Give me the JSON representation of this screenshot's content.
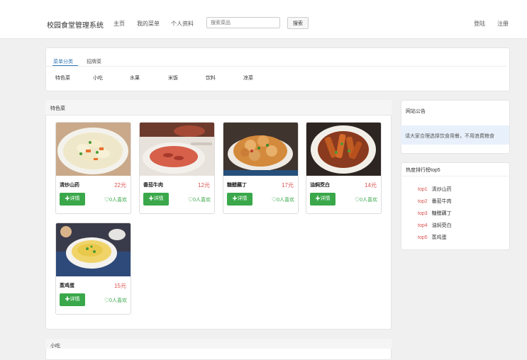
{
  "header": {
    "brand": "校园食堂管理系统",
    "nav": [
      "主页",
      "我的菜单",
      "个人资料"
    ],
    "search_placeholder": "搜索菜品",
    "search_button": "搜索",
    "login": "登陆",
    "register": "注册"
  },
  "menu": {
    "tabs": [
      "菜单分类",
      "招牌菜"
    ],
    "active_tab": "菜单分类",
    "categories": [
      "特色菜",
      "小吃",
      "水果",
      "米饭",
      "饮料",
      "凉菜"
    ]
  },
  "featured_section": {
    "title": "特色菜",
    "items": [
      {
        "name": "清炒山药",
        "price": "22元",
        "button": "✚详情",
        "likes": "♡0人喜欢"
      },
      {
        "name": "番茄牛肉",
        "price": "12元",
        "button": "✚详情",
        "likes": "♡0人喜欢"
      },
      {
        "name": "糖醋藕丁",
        "price": "17元",
        "button": "✚详情",
        "likes": "♡0人喜欢"
      },
      {
        "name": "油焖茭白",
        "price": "14元",
        "button": "✚详情",
        "likes": "♡0人喜欢"
      },
      {
        "name": "蒸鸡蛋",
        "price": "15元",
        "button": "✚详情",
        "likes": "♡0人喜欢"
      }
    ]
  },
  "snack_section": {
    "title": "小吃"
  },
  "announcement": {
    "title": "网站公告",
    "text": "请大家合理选择饮食用餐，不用浪费粮食"
  },
  "ranking": {
    "title": "热度排行榜top5",
    "items": [
      {
        "tag": "top1",
        "name": "清炒山药"
      },
      {
        "tag": "top2",
        "name": "番茄牛肉"
      },
      {
        "tag": "top3",
        "name": "糖醋藕丁"
      },
      {
        "tag": "top4",
        "name": "油焖茭白"
      },
      {
        "tag": "top5",
        "name": "蒸鸡蛋"
      }
    ]
  },
  "colors": {
    "accent": "#337ab7",
    "button_green": "#3aa84a",
    "price_red": "#d9534f"
  }
}
